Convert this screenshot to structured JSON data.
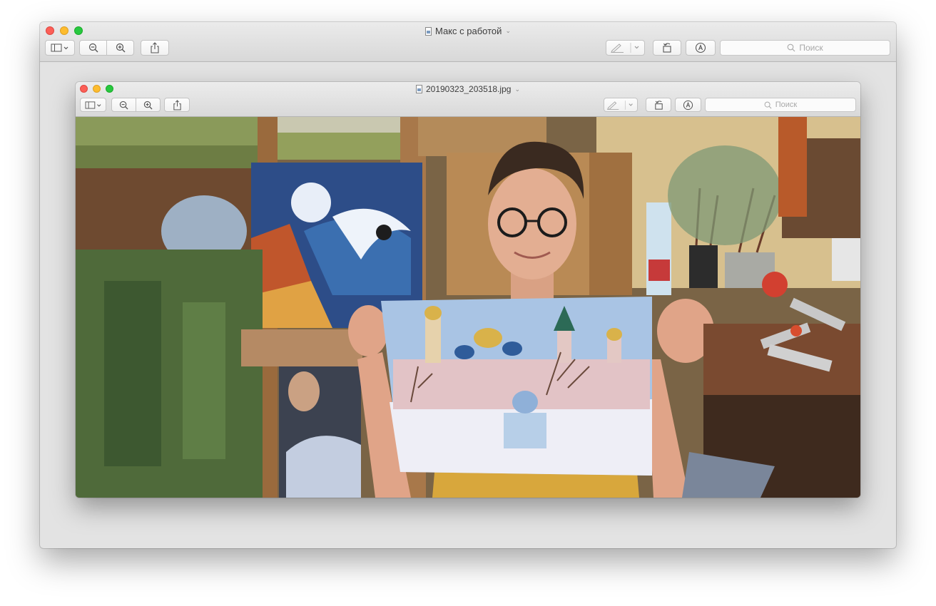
{
  "outer_window": {
    "title": "Макс с работой",
    "search_placeholder": "Поиск"
  },
  "inner_window": {
    "title": "20190323_203518.jpg",
    "search_placeholder": "Поиск"
  },
  "icons": {
    "sidebar": "sidebar-icon",
    "zoom_out": "zoom-out-icon",
    "zoom_in": "zoom-in-icon",
    "share": "share-icon",
    "markup_pen": "pen-icon",
    "rotate": "rotate-icon",
    "annotate": "annotate-icon",
    "search": "search-icon"
  }
}
